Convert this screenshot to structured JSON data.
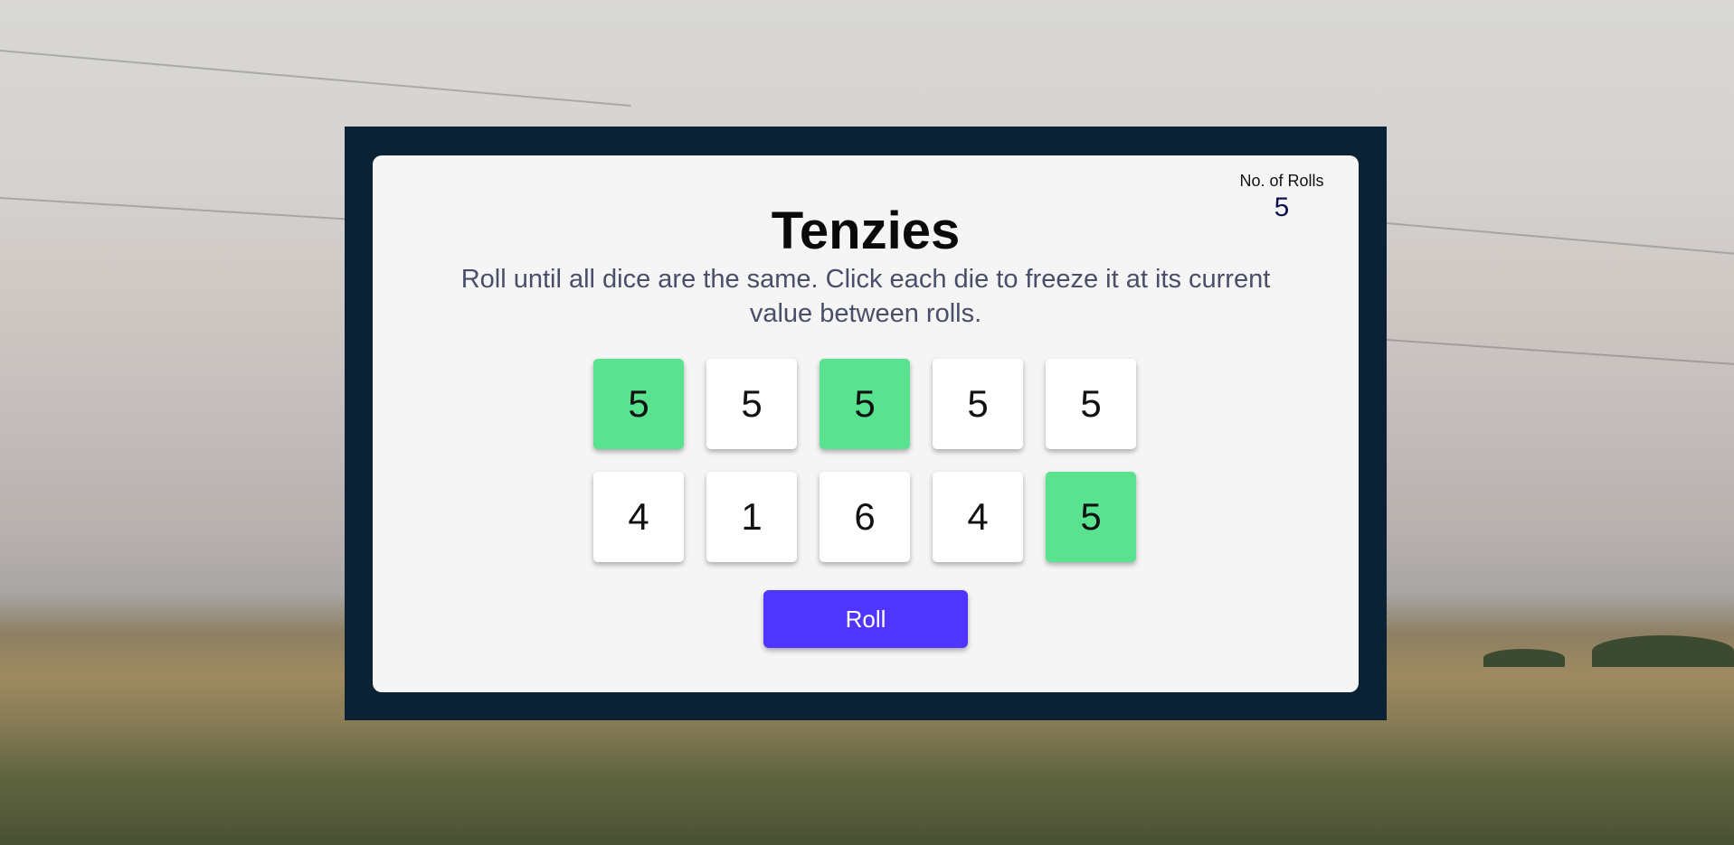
{
  "app": {
    "title": "Tenzies",
    "instructions": "Roll until all dice are the same. Click each die to freeze it at its current value between rolls."
  },
  "rolls": {
    "label": "No. of Rolls",
    "count": "5"
  },
  "dice": [
    {
      "value": "5",
      "held": true
    },
    {
      "value": "5",
      "held": false
    },
    {
      "value": "5",
      "held": true
    },
    {
      "value": "5",
      "held": false
    },
    {
      "value": "5",
      "held": false
    },
    {
      "value": "4",
      "held": false
    },
    {
      "value": "1",
      "held": false
    },
    {
      "value": "6",
      "held": false
    },
    {
      "value": "4",
      "held": false
    },
    {
      "value": "5",
      "held": true
    }
  ],
  "roll_button": {
    "label": "Roll"
  },
  "colors": {
    "frame": "#0b2235",
    "card": "#f5f5f5",
    "held_die": "#59e391",
    "die": "#ffffff",
    "button": "#5035ff"
  }
}
